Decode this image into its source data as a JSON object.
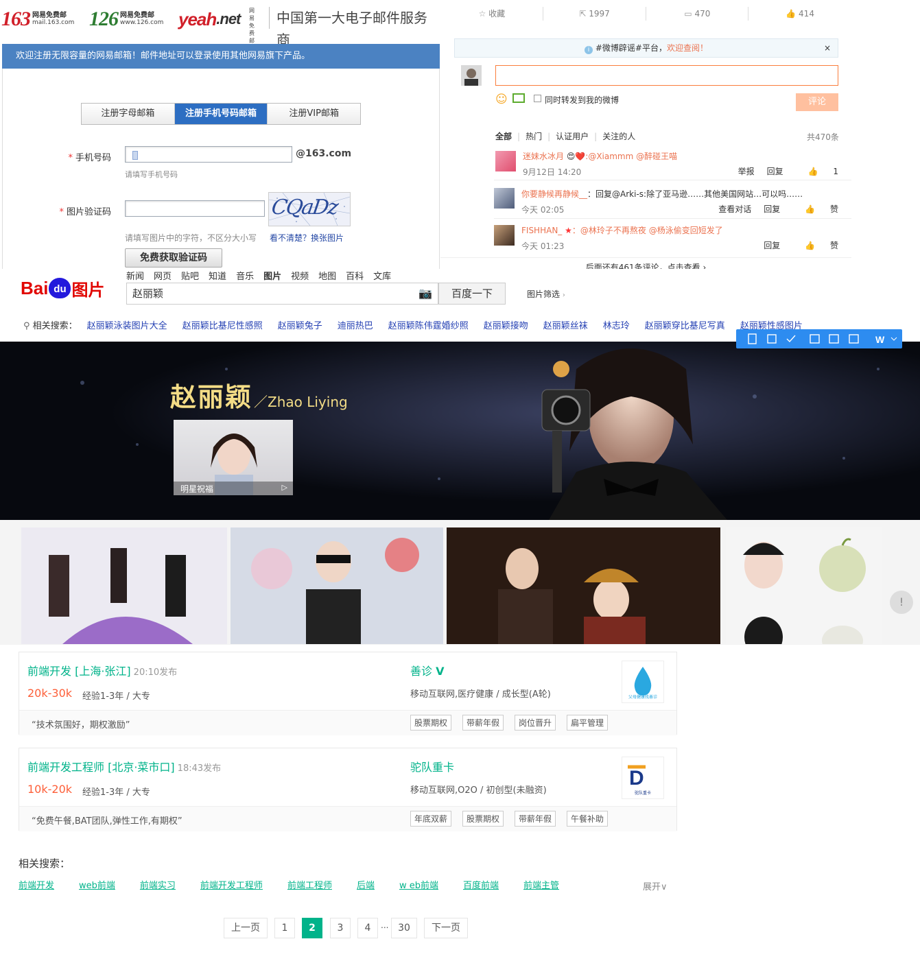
{
  "mail": {
    "brand163": {
      "num": "163",
      "sub": "网易免费邮",
      "domain": "mail.163.com"
    },
    "brand126": {
      "num": "126",
      "sub": "网易免费邮",
      "domain": "www.126.com"
    },
    "brandyeah": {
      "text": "yeah",
      "suffix": ".net",
      "sub": "网易免费邮"
    },
    "slogan": "中国第一大电子邮件服务商",
    "banner": "欢迎注册无限容量的网易邮箱！邮件地址可以登录使用其他网易旗下产品。",
    "tabs": [
      "注册字母邮箱",
      "注册手机号码邮箱",
      "注册VIP邮箱"
    ],
    "phone_label": "手机号码",
    "phone_suffix": "@163.com",
    "phone_hint": "请填写手机号码",
    "captcha_label": "图片验证码",
    "captcha_hint": "请填写图片中的字符，不区分大小写",
    "captcha_refresh": "看不清楚？换张图片",
    "captcha_text": "CQaDz",
    "get_code_button": "免费获取验证码"
  },
  "weibo": {
    "stats": [
      {
        "icon": "star-icon",
        "label": "收藏"
      },
      {
        "icon": "repost-icon",
        "label": "1997"
      },
      {
        "icon": "comment-icon",
        "label": "470"
      },
      {
        "icon": "like-icon",
        "label": "414"
      }
    ],
    "notice_prefix": "#微博辟谣#平台，",
    "notice_link": "欢迎查阅！",
    "notice_close": "×",
    "repost_checkbox": "同时转发到我的微博",
    "submit": "评论",
    "filters": [
      "全部",
      "热门",
      "认证用户",
      "关注的人"
    ],
    "total": "共470条",
    "comments": [
      {
        "nick": "迷妹水冰月",
        "sep": " 😍❤️",
        "text": ":@Xiammm @醉碰王喵",
        "time": "9月12日 14:20",
        "ops": [
          "举报",
          "回复",
          "1"
        ]
      },
      {
        "nick": "你要静候再静候__",
        "sep": "",
        "text": "：回复@Arki-s:除了亚马逊……其他美国网站…可以吗……",
        "time": "今天 02:05",
        "ops": [
          "查看对话",
          "回复",
          "赞"
        ]
      },
      {
        "nick": "FISHHAN_",
        "sep": " ★",
        "text": "：@林玲子不再熬夜 @杨泳偷变回短发了",
        "time": "今天 01:23",
        "ops": [
          "回复",
          "赞"
        ]
      }
    ],
    "more": "后面还有461条评论，点击查看 ›"
  },
  "baidu": {
    "nav": [
      "新闻",
      "网页",
      "贴吧",
      "知道",
      "音乐",
      "图片",
      "视频",
      "地图",
      "百科",
      "文库"
    ],
    "nav_active": "图片",
    "logo_bai": "Bai",
    "logo_du": "du",
    "logo_tupian": "图片",
    "query": "赵丽颖",
    "search_button": "百度一下",
    "filter": "图片筛选",
    "related_label": "相关搜索：",
    "related": [
      "赵丽颖泳装图片大全",
      "赵丽颖比基尼性感照",
      "赵丽颖兔子",
      "迪丽热巴",
      "赵丽颖陈伟霆婚纱照",
      "赵丽颖接吻",
      "赵丽颖丝袜",
      "林志玲",
      "赵丽颖穿比基尼写真",
      "赵丽颖性感图片"
    ],
    "hero_name": "赵丽颖",
    "hero_en": "／Zhao Liying",
    "hero_thumb_caption": "明星祝福",
    "side_feedback": "!"
  },
  "jobs": [
    {
      "title": "前端开发 [上海·张江]",
      "time": "20:10发布",
      "salary": "20k-30k",
      "req": "经验1-3年 / 大专",
      "company": "善诊",
      "verified": "V",
      "industry": "移动互联网,医疗健康 / 成长型(A轮)",
      "slogan": "“技术氛围好，期权激励”",
      "tags": [
        "股票期权",
        "带薪年假",
        "岗位晋升",
        "扁平管理"
      ],
      "logo_text": "父母健康找善诊"
    },
    {
      "title": "前端开发工程师 [北京·菜市口]",
      "time": "18:43发布",
      "salary": "10k-20k",
      "req": "经验1-3年 / 大专",
      "company": "驼队重卡",
      "verified": "",
      "industry": "移动互联网,O2O / 初创型(未融资)",
      "slogan": "“免费午餐,BAT团队,弹性工作,有期权”",
      "tags": [
        "年底双薪",
        "股票期权",
        "带薪年假",
        "午餐补助"
      ],
      "logo_text": "驼队重卡"
    }
  ],
  "related_search": {
    "title": "相关搜索：",
    "links": [
      "前端开发",
      "web前端",
      "前端实习",
      "前端开发工程师",
      "前端工程师",
      "后端",
      "w eb前端",
      "百度前端",
      "前端主管"
    ],
    "expand": "展开"
  },
  "pagination": {
    "prev": "上一页",
    "pages": [
      "1",
      "2",
      "3",
      "4"
    ],
    "current": "2",
    "ellipsis": "...",
    "last": "30",
    "next": "下一页"
  }
}
